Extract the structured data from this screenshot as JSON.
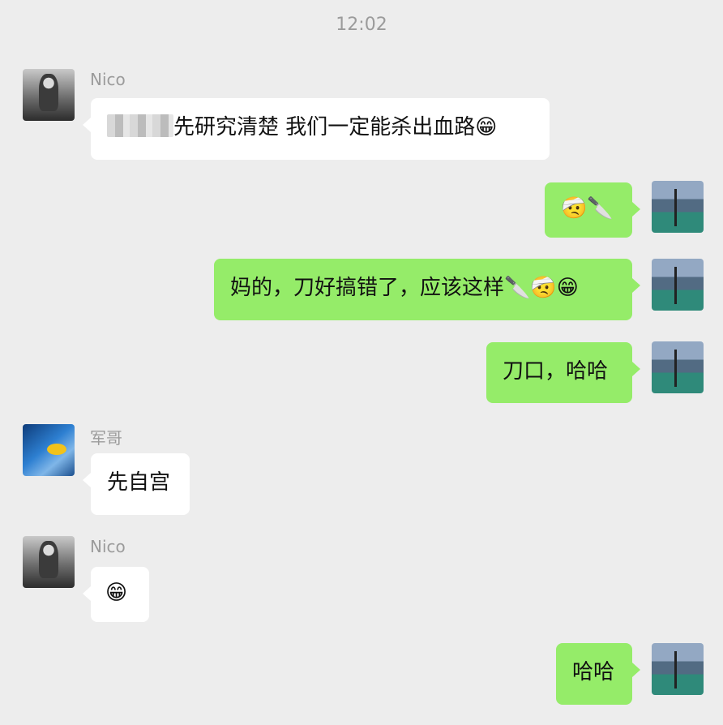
{
  "chat": {
    "timestamp": "12:02",
    "messages": [
      {
        "sender": "Nico",
        "direction": "incoming",
        "text": "先研究清楚 我们一定能杀出血路😁",
        "redacted_prefix": true
      },
      {
        "sender": "me",
        "direction": "outgoing",
        "text": "🤕🔪"
      },
      {
        "sender": "me",
        "direction": "outgoing",
        "text": "妈的，刀好搞错了，应该这样🔪🤕😁"
      },
      {
        "sender": "me",
        "direction": "outgoing",
        "text": "刀口，哈哈"
      },
      {
        "sender": "军哥",
        "direction": "incoming",
        "text": "先自宫"
      },
      {
        "sender": "Nico",
        "direction": "incoming",
        "text": "😁"
      },
      {
        "sender": "me",
        "direction": "outgoing",
        "text": "哈哈"
      }
    ]
  },
  "colors": {
    "background": "#ededed",
    "incoming_bubble": "#ffffff",
    "outgoing_bubble": "#95ec69",
    "meta_text": "#9b9b9b"
  }
}
